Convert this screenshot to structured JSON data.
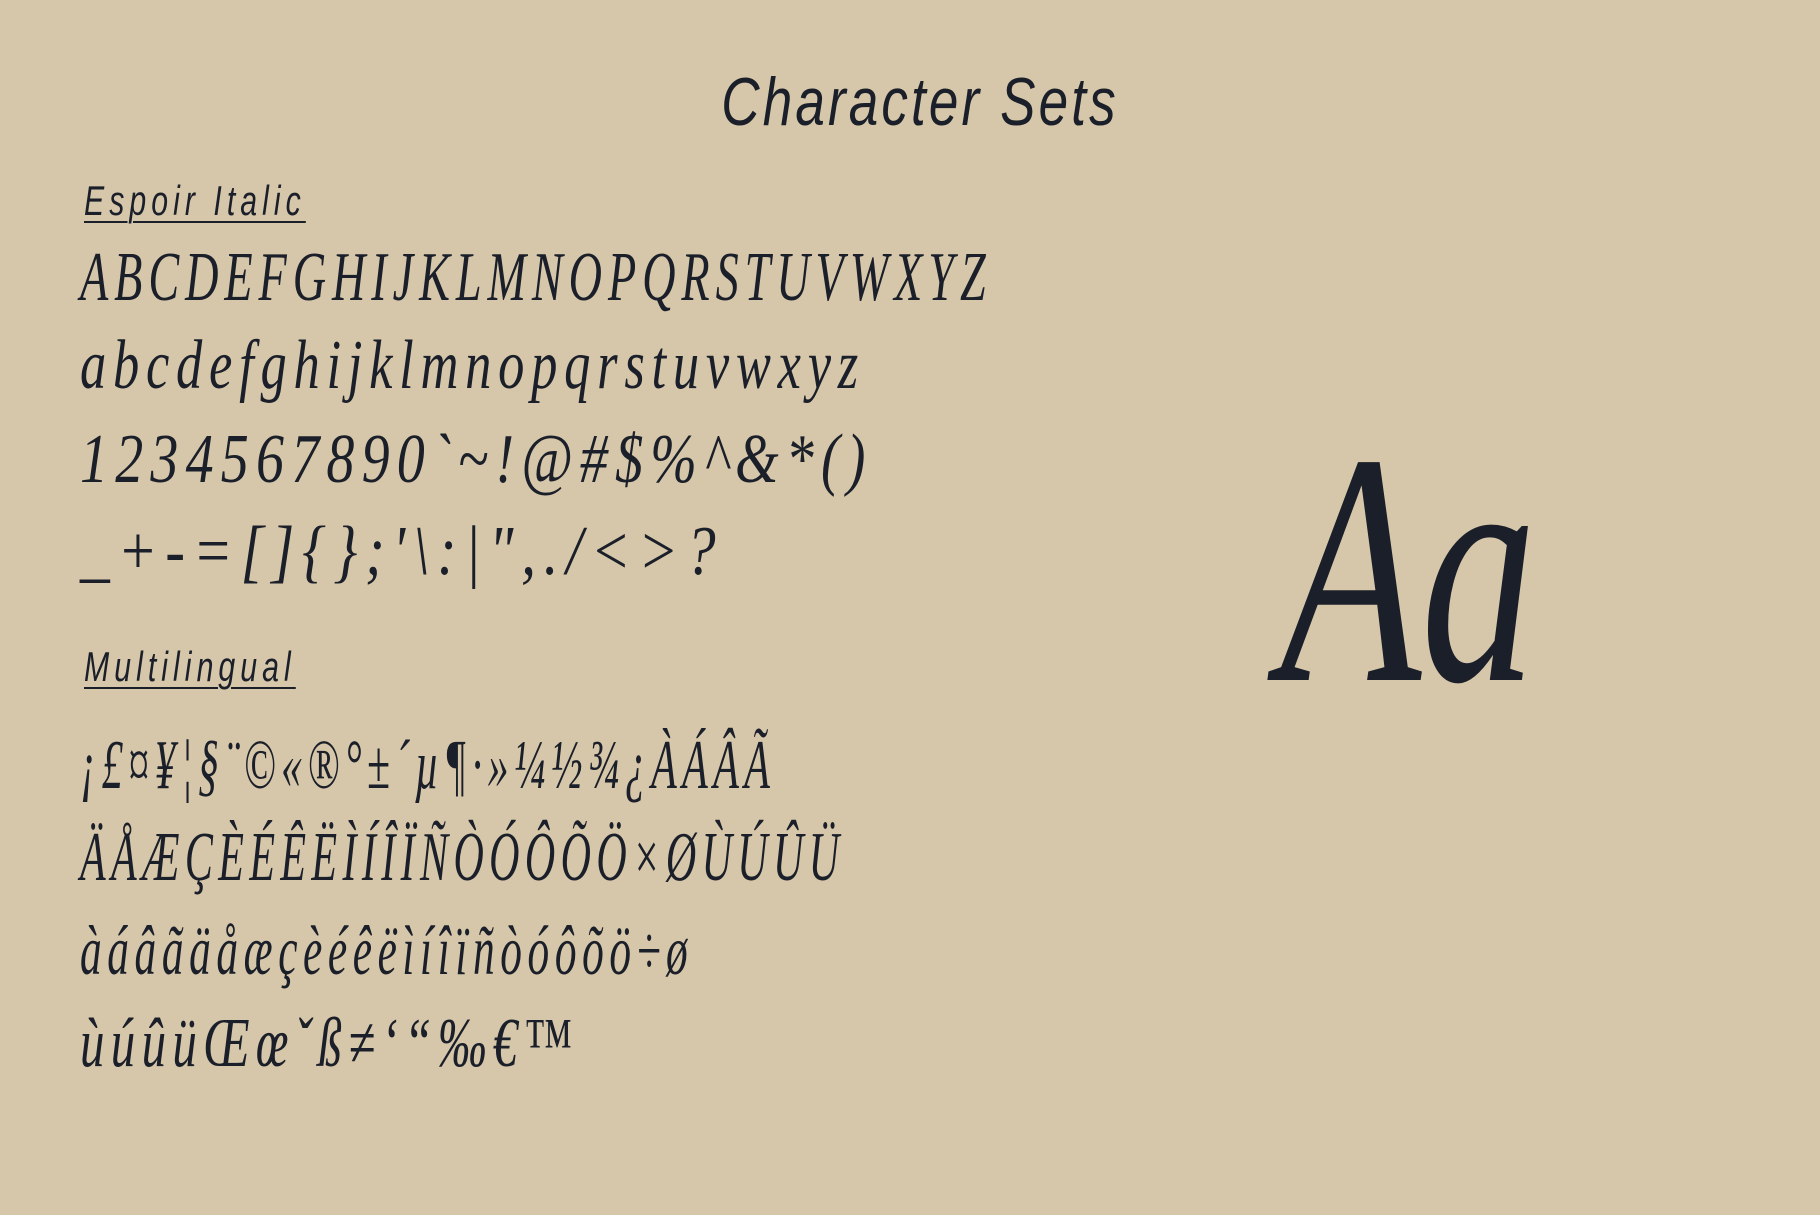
{
  "title": "Character Sets",
  "sections": {
    "primary": {
      "heading": "Espoir Italic",
      "rows": [
        "ABCDEFGHIJKLMNOPQRSTUVWXYZ",
        "abcdefghijklmnopqrstuvwxyz",
        "1234567890`~!@#$%^&*()",
        "_+-=[]{};'\\:|\",./<>?"
      ]
    },
    "multilingual": {
      "heading": "Multilingual",
      "rows": [
        "¡£¤¥¦§¨©«®°±´µ¶·»¼½¾¿ÀÁÂÃ",
        "ÄÅÆÇÈÉÊËÌÍÎÏÑÒÓÔÕÖ×ØÙÚÛÜ",
        "àáâãäåæçèéêëìíîïñòóôõö÷ø",
        "ùúûüŒœˇß≠‘“‰€™"
      ]
    }
  },
  "sample": "Aa"
}
